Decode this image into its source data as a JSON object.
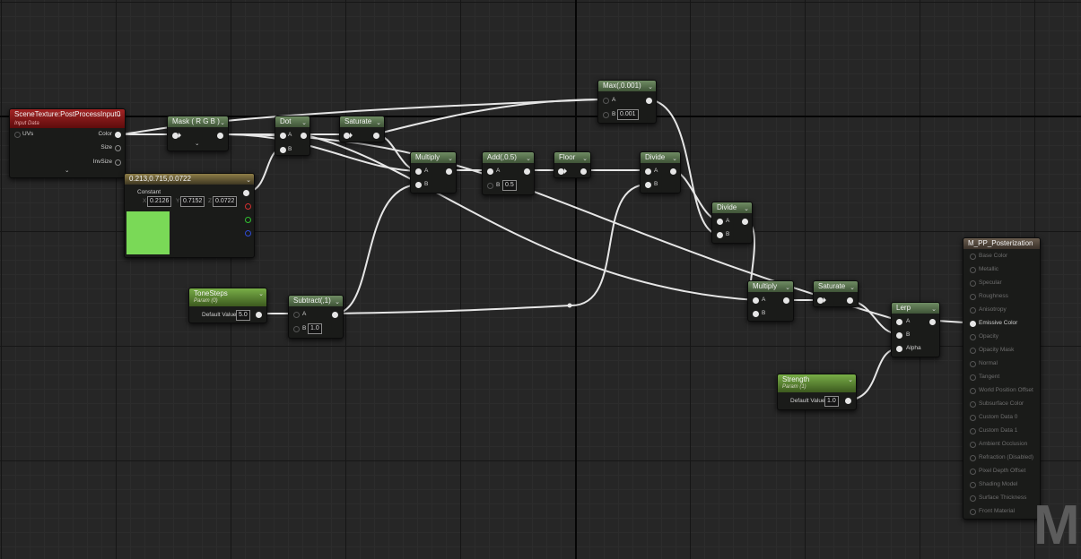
{
  "colors": {
    "wire": "#e6e6e6",
    "grid_bg": "#262626",
    "operator_header": "#5a7450",
    "texture_header": "#8b1c1c",
    "constant_header": "#7a6b3a",
    "param_header": "#68953c",
    "swatch": "#7ad957"
  },
  "nodes": {
    "scene_texture": {
      "title": "SceneTexture:PostProcessInput0",
      "subtitle": "Input Data",
      "pin_uvs": "UVs",
      "pin_color": "Color",
      "pin_size": "Size",
      "pin_invsize": "InvSize"
    },
    "mask": {
      "title": "Mask ( R G B )"
    },
    "dot": {
      "title": "Dot",
      "pin_a": "A",
      "pin_b": "B"
    },
    "saturate1": {
      "title": "Saturate"
    },
    "constant3": {
      "title": "0.213,0.715,0.0722",
      "label": "Constant",
      "x_label": "X",
      "x_value": "0.2126",
      "y_label": "Y",
      "y_value": "0.7152",
      "z_label": "Z",
      "z_value": "0.0722"
    },
    "multiply1": {
      "title": "Multiply",
      "pin_a": "A",
      "pin_b": "B"
    },
    "add": {
      "title": "Add(,0.5)",
      "pin_a": "A",
      "pin_b": "B",
      "b_value": "0.5"
    },
    "floor": {
      "title": "Floor"
    },
    "max": {
      "title": "Max(,0.001)",
      "pin_a": "A",
      "pin_b": "B",
      "b_value": "0.001"
    },
    "divide1": {
      "title": "Divide",
      "pin_a": "A",
      "pin_b": "B"
    },
    "divide2": {
      "title": "Divide",
      "pin_a": "A",
      "pin_b": "B"
    },
    "multiply2": {
      "title": "Multiply",
      "pin_a": "A",
      "pin_b": "B"
    },
    "saturate2": {
      "title": "Saturate"
    },
    "lerp": {
      "title": "Lerp",
      "pin_a": "A",
      "pin_b": "B",
      "pin_alpha": "Alpha"
    },
    "tonesteps": {
      "title": "ToneSteps",
      "subtitle": "Param (0)",
      "default_label": "Default Value",
      "default_value": "5.0"
    },
    "subtract": {
      "title": "Subtract(,1)",
      "pin_a": "A",
      "pin_b": "B",
      "b_value": "1.0"
    },
    "strength": {
      "title": "Strength",
      "subtitle": "Param (1)",
      "default_label": "Default Value",
      "default_value": "1.0"
    },
    "result": {
      "title": "M_PP_Posterization",
      "pins": [
        "Base Color",
        "Metallic",
        "Specular",
        "Roughness",
        "Anisotropy",
        "Emissive Color",
        "Opacity",
        "Opacity Mask",
        "Normal",
        "Tangent",
        "World Position Offset",
        "Subsurface Color",
        "Custom Data 0",
        "Custom Data 1",
        "Ambient Occlusion",
        "Refraction (Disabled)",
        "Pixel Depth Offset",
        "Shading Model",
        "Surface Thickness",
        "Front Material"
      ],
      "active_pin": "Emissive Color"
    }
  },
  "watermark": "MA"
}
